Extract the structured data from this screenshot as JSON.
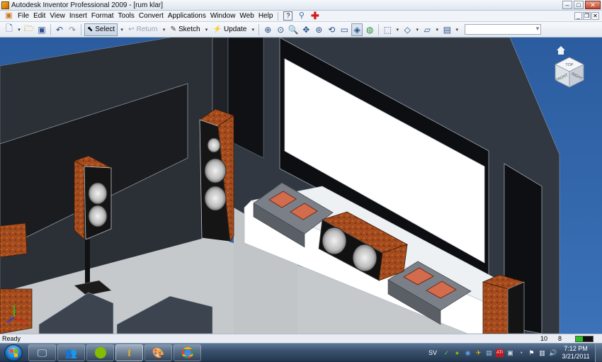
{
  "window": {
    "title": "Autodesk Inventor Professional 2009 - [rum klar]"
  },
  "menu": {
    "items": [
      "File",
      "Edit",
      "View",
      "Insert",
      "Format",
      "Tools",
      "Convert",
      "Applications",
      "Window",
      "Web",
      "Help"
    ]
  },
  "toolbar": {
    "select_label": "Select",
    "return_label": "Return",
    "sketch_label": "Sketch",
    "update_label": "Update"
  },
  "viewcube": {
    "top": "TOP",
    "front": "FRONT",
    "right": "RIGHT"
  },
  "status": {
    "text": "Ready",
    "count_a": "10",
    "count_b": "8"
  },
  "tray": {
    "language": "SV",
    "time": "7:12 PM",
    "date": "3/21/2011"
  },
  "colors": {
    "desktop_blue": "#2c5ea3",
    "wood": "#a24a1d",
    "screen": "#ffffff",
    "floor": "#c6c9cc"
  }
}
